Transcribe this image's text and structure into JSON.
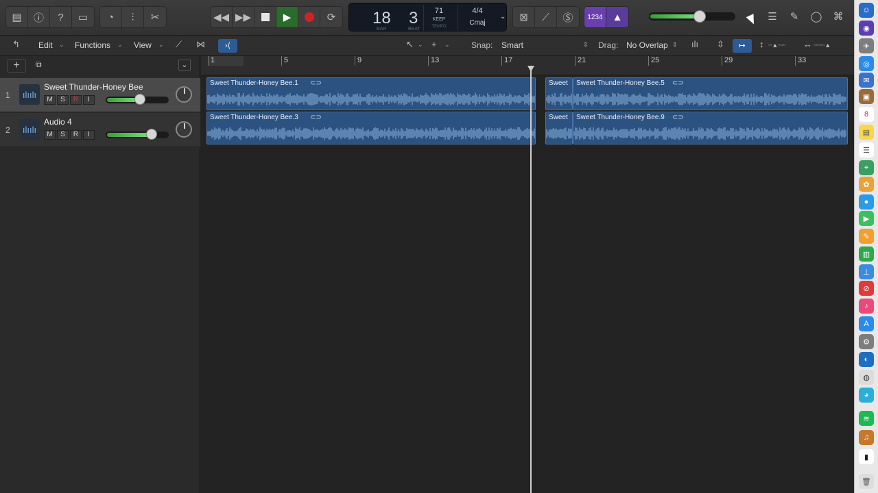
{
  "toolbar": {
    "left_icons": [
      "library-icon",
      "inspector-icon",
      "quick-help-icon",
      "toolbar-toggle-icon"
    ],
    "edit_icons": [
      "smart-controls-icon",
      "mixer-icon",
      "editors-icon"
    ],
    "transport": [
      "rewind-icon",
      "fast-forward-icon",
      "stop-icon",
      "play-icon",
      "record-icon",
      "cycle-icon"
    ]
  },
  "lcd": {
    "bar": "18",
    "beat": "3",
    "bar_label": "BAR",
    "beat_label": "BEAT",
    "tempo": "71",
    "tempo_keep": "KEEP",
    "tempo_label": "TEMPO",
    "time_signature": "4/4",
    "key": "Cmaj"
  },
  "mode_buttons": {
    "count_in": "1234",
    "master_volume_level": 0.6
  },
  "edit_bar": {
    "edit_menu": "Edit",
    "functions_menu": "Functions",
    "view_menu": "View",
    "snap_label": "Snap:",
    "snap_value": "Smart",
    "drag_label": "Drag:",
    "drag_value": "No Overlap"
  },
  "ruler": {
    "bars": [
      "1",
      "5",
      "9",
      "13",
      "17",
      "21",
      "25",
      "29",
      "33"
    ]
  },
  "tracks": [
    {
      "number": "1",
      "name": "Sweet Thunder-Honey Bee",
      "mute": "M",
      "solo": "S",
      "record": "R",
      "input": "I",
      "volume_level": 0.55,
      "selected": true
    },
    {
      "number": "2",
      "name": "Audio 4",
      "mute": "M",
      "solo": "S",
      "record": "R",
      "input": "I",
      "volume_level": 0.78,
      "selected": false
    }
  ],
  "regions": {
    "r1": "Sweet Thunder-Honey Bee.1",
    "r2": "Sweet",
    "r3": "Sweet Thunder-Honey Bee.5",
    "r4": "Sweet Thunder-Honey Bee.3",
    "r5": "Sweet",
    "r6": "Sweet Thunder-Honey Bee.9"
  },
  "colors": {
    "region": "#2b5280",
    "play_active": "#2b6b2b",
    "record": "#d02424",
    "count_in": "#6a3fb0"
  }
}
